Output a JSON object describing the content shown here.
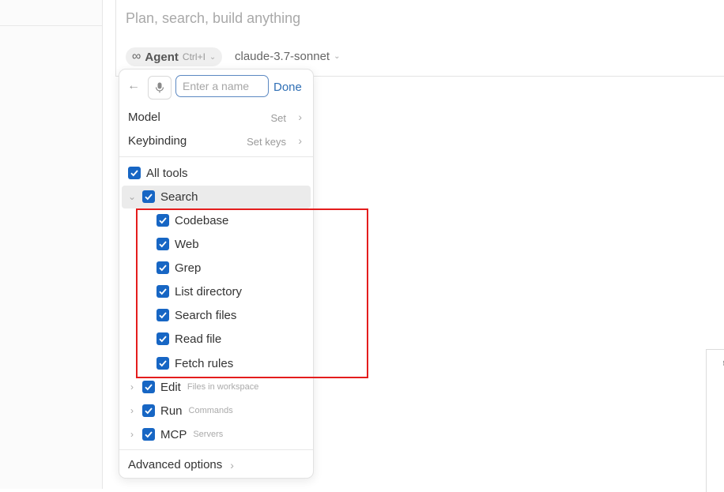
{
  "composer": {
    "placeholder": "Plan, search, build anything",
    "mode_label": "Agent",
    "mode_shortcut": "Ctrl+I",
    "model_name": "claude-3.7-sonnet"
  },
  "popup": {
    "name_placeholder": "Enter a name",
    "done_label": "Done",
    "settings": [
      {
        "label": "Model",
        "value": "Set"
      },
      {
        "label": "Keybinding",
        "value": "Set keys"
      }
    ],
    "all_tools_label": "All tools",
    "groups": [
      {
        "label": "Search",
        "expanded": true,
        "checked": true,
        "tools": [
          {
            "label": "Codebase",
            "checked": true
          },
          {
            "label": "Web",
            "checked": true
          },
          {
            "label": "Grep",
            "checked": true
          },
          {
            "label": "List directory",
            "checked": true
          },
          {
            "label": "Search files",
            "checked": true
          },
          {
            "label": "Read file",
            "checked": true
          },
          {
            "label": "Fetch rules",
            "checked": true
          }
        ]
      },
      {
        "label": "Edit",
        "sublabel": "Files in workspace",
        "expanded": false,
        "checked": true
      },
      {
        "label": "Run",
        "sublabel": "Commands",
        "expanded": false,
        "checked": true
      },
      {
        "label": "MCP",
        "sublabel": "Servers",
        "expanded": false,
        "checked": true
      }
    ],
    "advanced_label": "Advanced options"
  },
  "colors": {
    "accent": "#1766c4",
    "link": "#2f6fb5",
    "highlight_box": "#e41d1d"
  },
  "icons": [
    "infinity-icon",
    "back-arrow-icon",
    "microphone-icon",
    "checkbox-checked-icon",
    "chevron-right-icon",
    "chevron-down-icon"
  ]
}
